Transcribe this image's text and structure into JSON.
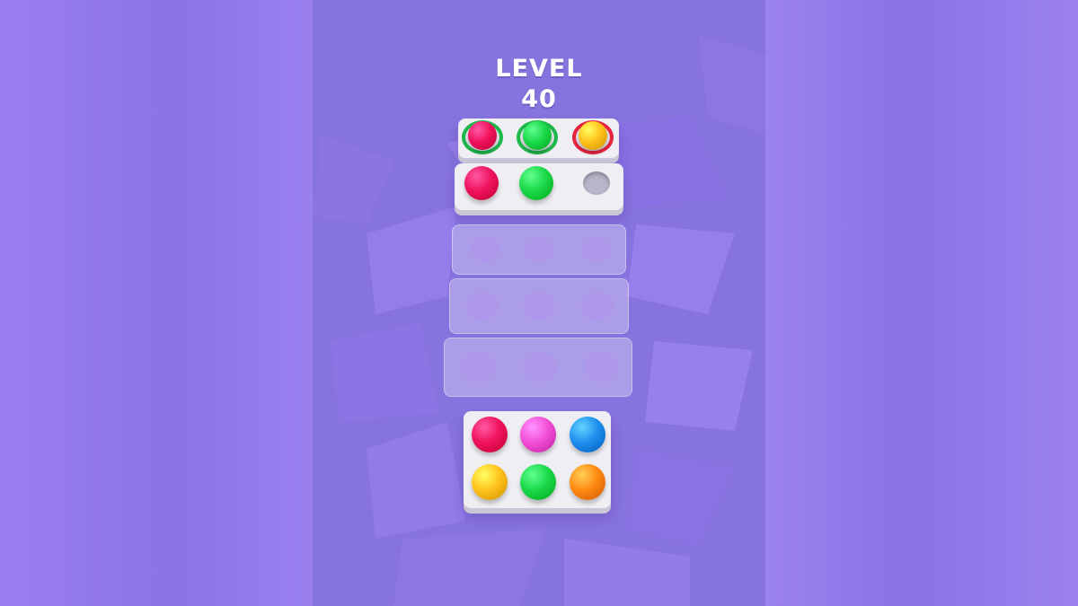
{
  "level": {
    "label": "LEVEL",
    "number": "40"
  },
  "colors": {
    "red": "#f0135e",
    "green": "#1bd94a",
    "yellow": "#ffc21c",
    "pink": "#f24fd6",
    "blue": "#1f8fee",
    "orange": "#ff8a12",
    "ring_green": "#1fb84a",
    "ring_red": "#e7243f"
  },
  "target_row": [
    {
      "ball": "red",
      "ring": "green"
    },
    {
      "ball": "green",
      "ring": "green"
    },
    {
      "ball": "yellow",
      "ring": "red"
    }
  ],
  "trays": [
    [
      "red",
      "green",
      null
    ],
    [
      null,
      null,
      null
    ],
    [
      null,
      null,
      null
    ],
    [
      null,
      null,
      null
    ]
  ],
  "palette": [
    [
      "red",
      "pink",
      "blue"
    ],
    [
      "yellow",
      "green",
      "orange"
    ]
  ]
}
